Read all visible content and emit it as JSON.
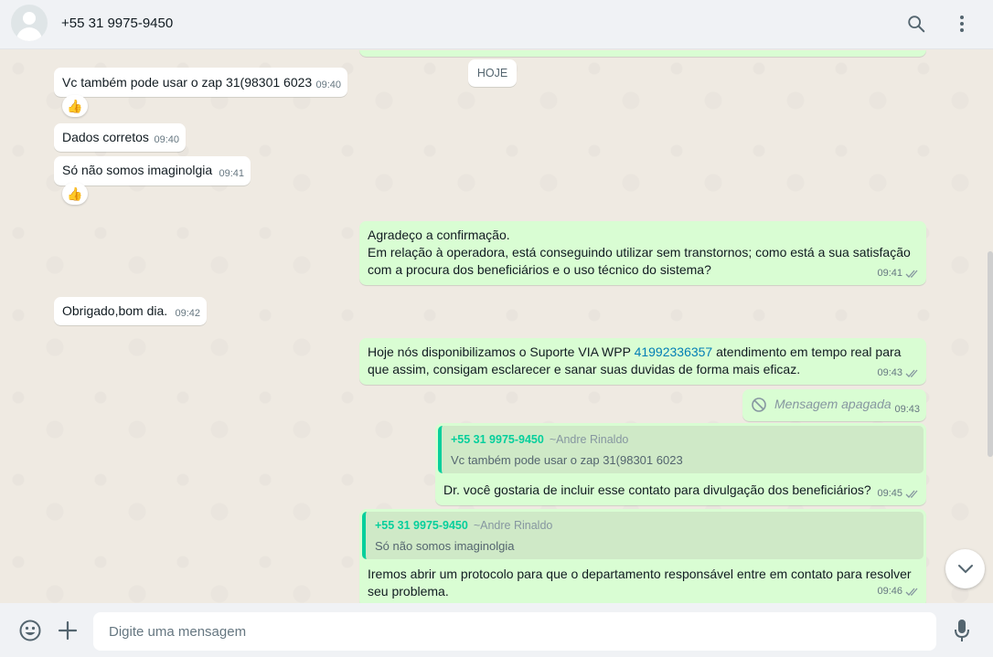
{
  "header": {
    "contact_name": "+55 31 9975-9450",
    "icons": [
      "search-icon",
      "menu-icon",
      "avatar-icon"
    ]
  },
  "chat": {
    "date_chip": "HOJE",
    "messages": [
      {
        "text": "Vc também pode usar o zap 31(98301 6023",
        "time": "09:40",
        "reaction": "👍"
      },
      {
        "text": "Dados corretos",
        "time": "09:40"
      },
      {
        "text": "Só não somos imaginolgia",
        "time": "09:41",
        "reaction": "👍"
      },
      {
        "text": "Agradeço a confirmação.\nEm relação à operadora, está conseguindo utilizar sem transtornos; como está a sua satisfação\ncom a procura dos beneficiários e o uso técnico do sistema?",
        "time": "09:41"
      },
      {
        "text": "Obrigado,bom dia.",
        "time": "09:42"
      },
      {
        "text_before": "Hoje nós disponibilizamos o Suporte VIA WPP ",
        "link": "41992336357",
        "text_after": " atendimento em tempo real para\nque assim, consigam esclarecer e sanar suas duvidas de forma mais eficaz.",
        "time": "09:43"
      },
      {
        "deleted_text": "Mensagem apagada",
        "time": "09:43"
      },
      {
        "quote_author": "+55 31 9975-9450",
        "quote_alias": "~Andre Rinaldo",
        "quote_text": "Vc também pode usar o zap 31(98301 6023",
        "text": "Dr. você gostaria de incluir esse contato para divulgação dos beneficiários?",
        "time": "09:45"
      },
      {
        "quote_author": "+55 31 9975-9450",
        "quote_alias": "~Andre Rinaldo",
        "quote_text": "Só não somos imaginolgia",
        "text": "Iremos abrir um protocolo para que o departamento responsável entre em contato para resolver\nseu problema.",
        "time": "09:46"
      }
    ]
  },
  "composer": {
    "placeholder": "Digite uma mensagem",
    "value": ""
  },
  "colors": {
    "incoming_bubble": "#ffffff",
    "outgoing_bubble": "#d9fdd3",
    "quote_accent": "#06cf9c",
    "link": "#027eb5",
    "read_ticks": "#8696a0"
  }
}
